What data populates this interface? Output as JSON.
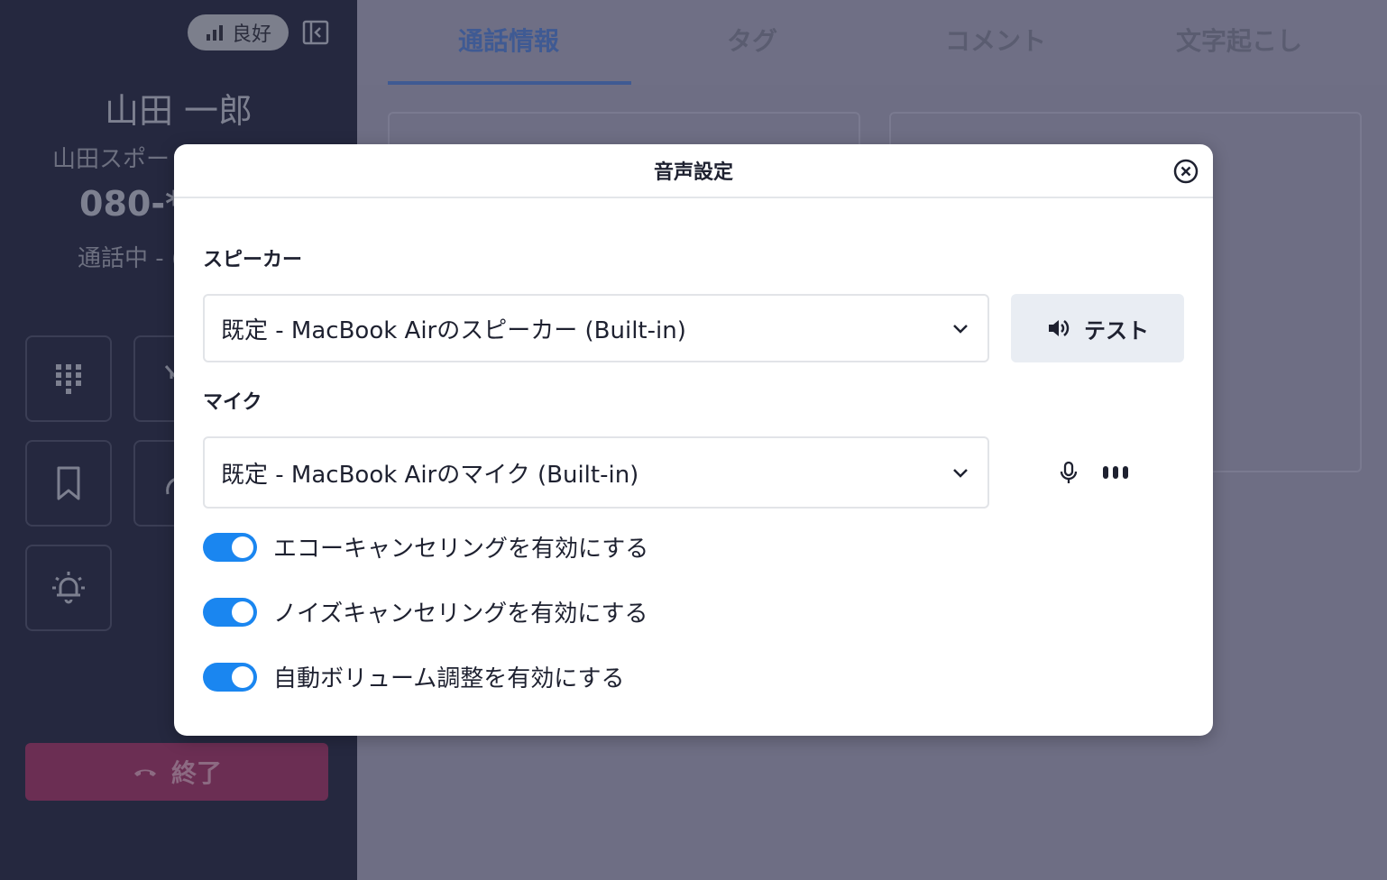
{
  "sidebar": {
    "signal_label": "良好",
    "caller_name": "山田 一郎",
    "caller_company": "山田スポー",
    "caller_phone": "080-**",
    "call_status": "通話中 - (",
    "end_call_label": "終了"
  },
  "tabs": [
    {
      "label": "通話情報",
      "active": true
    },
    {
      "label": "タグ",
      "active": false
    },
    {
      "label": "コメント",
      "active": false
    },
    {
      "label": "文字起こし",
      "active": false
    }
  ],
  "modal": {
    "title": "音声設定",
    "speaker": {
      "label": "スピーカー",
      "selected": "既定 - MacBook Airのスピーカー (Built-in)",
      "test_label": "テスト"
    },
    "mic": {
      "label": "マイク",
      "selected": "既定 - MacBook Airのマイク (Built-in)"
    },
    "toggles": [
      {
        "label": "エコーキャンセリングを有効にする",
        "on": true
      },
      {
        "label": "ノイズキャンセリングを有効にする",
        "on": true
      },
      {
        "label": "自動ボリューム調整を有効にする",
        "on": true
      }
    ]
  },
  "colors": {
    "accent": "#1a86f0",
    "sidebar_bg": "#25283f",
    "overlay_bg": "#6e6e84",
    "end_call": "#6b2e53"
  }
}
